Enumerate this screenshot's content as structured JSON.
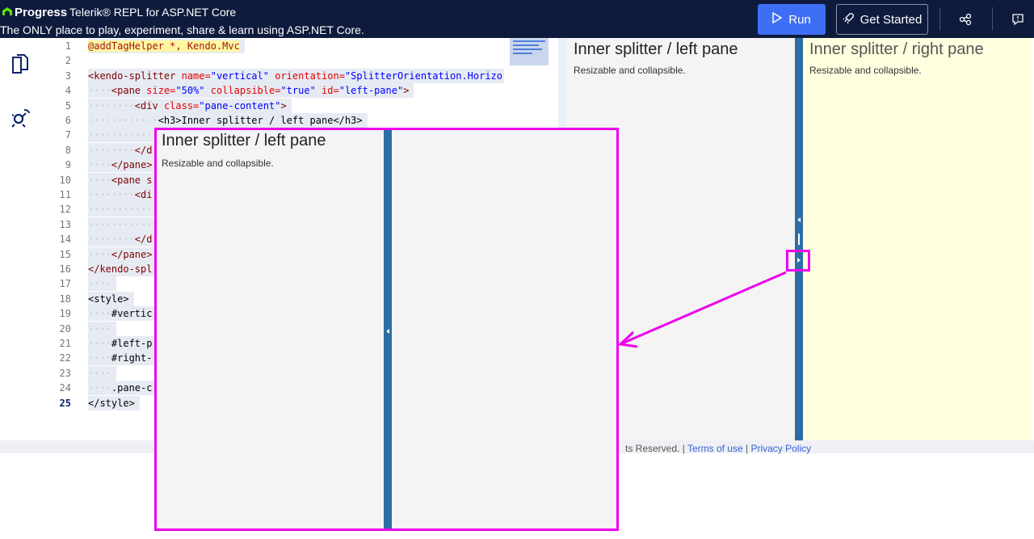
{
  "header": {
    "brand_progress": "Progress",
    "brand_product": "Telerik® REPL for ASP.NET Core",
    "tagline": "The ONLY place to play, experiment, share & learn using ASP.NET Core.",
    "run_label": "Run",
    "get_started_label": "Get Started",
    "icons": [
      "share-icon",
      "feedback-icon"
    ]
  },
  "rail": {
    "icons": [
      "files-icon",
      "settings-icon"
    ]
  },
  "editor": {
    "active_line": 25,
    "lines": [
      {
        "n": "1"
      },
      {
        "n": "2"
      },
      {
        "n": "3"
      },
      {
        "n": "4"
      },
      {
        "n": "5"
      },
      {
        "n": "6"
      },
      {
        "n": "7"
      },
      {
        "n": "8"
      },
      {
        "n": "9"
      },
      {
        "n": "10"
      },
      {
        "n": "11"
      },
      {
        "n": "12"
      },
      {
        "n": "13"
      },
      {
        "n": "14"
      },
      {
        "n": "15"
      },
      {
        "n": "16"
      },
      {
        "n": "17"
      },
      {
        "n": "18"
      },
      {
        "n": "19"
      },
      {
        "n": "20"
      },
      {
        "n": "21"
      },
      {
        "n": "22"
      },
      {
        "n": "23"
      },
      {
        "n": "24"
      },
      {
        "n": "25"
      }
    ],
    "code": {
      "l1": "@addTagHelper *, Kendo.Mvc",
      "l3_tag": "<kendo-splitter",
      "l3_attr1": "name=",
      "l3_val1": "\"vertical\"",
      "l3_attr2": "orientation=",
      "l3_val2": "\"SplitterOrientation.Horizo",
      "l4_tag": "<pane",
      "l4_attr1": "size=",
      "l4_val1": "\"50%\"",
      "l4_attr2": "collapsible=",
      "l4_val2": "\"true\"",
      "l4_attr3": "id=",
      "l4_val3": "\"left-pane\"",
      "l4_end": ">",
      "l5_tag": "<div",
      "l5_attr": "class=",
      "l5_val": "\"pane-content\"",
      "l5_end": ">",
      "l6_text": "<h3>Inner splitter / left pane</h3>",
      "l8": "</d",
      "l9": "</pane>",
      "l10": "<pane s",
      "l11": "<di",
      "l14": "</d",
      "l15": "</pane>",
      "l16": "</kendo-spl",
      "l18": "<style>",
      "l19": "#vertic",
      "l21": "#left-p",
      "l22": "#right-",
      "l24": ".pane-c",
      "l25": "</style>"
    }
  },
  "preview": {
    "left_title": "Inner splitter / left pane",
    "left_desc": "Resizable and collapsible.",
    "right_title": "Inner splitter / right pane",
    "right_desc": "Resizable and collapsible."
  },
  "footer": {
    "text_prefix": "ts Reserved. | ",
    "terms": "Terms of use",
    "sep": " | ",
    "privacy": "Privacy Policy"
  },
  "zoom": {
    "title": "Inner splitter / left pane",
    "desc": "Resizable and collapsible."
  },
  "colors": {
    "header_bg": "#0e1b3d",
    "run_button": "#3e6ef4",
    "splitbar": "#2e6da4",
    "right_pane_bg": "#ffffe0",
    "annotation": "#ee00ee"
  }
}
